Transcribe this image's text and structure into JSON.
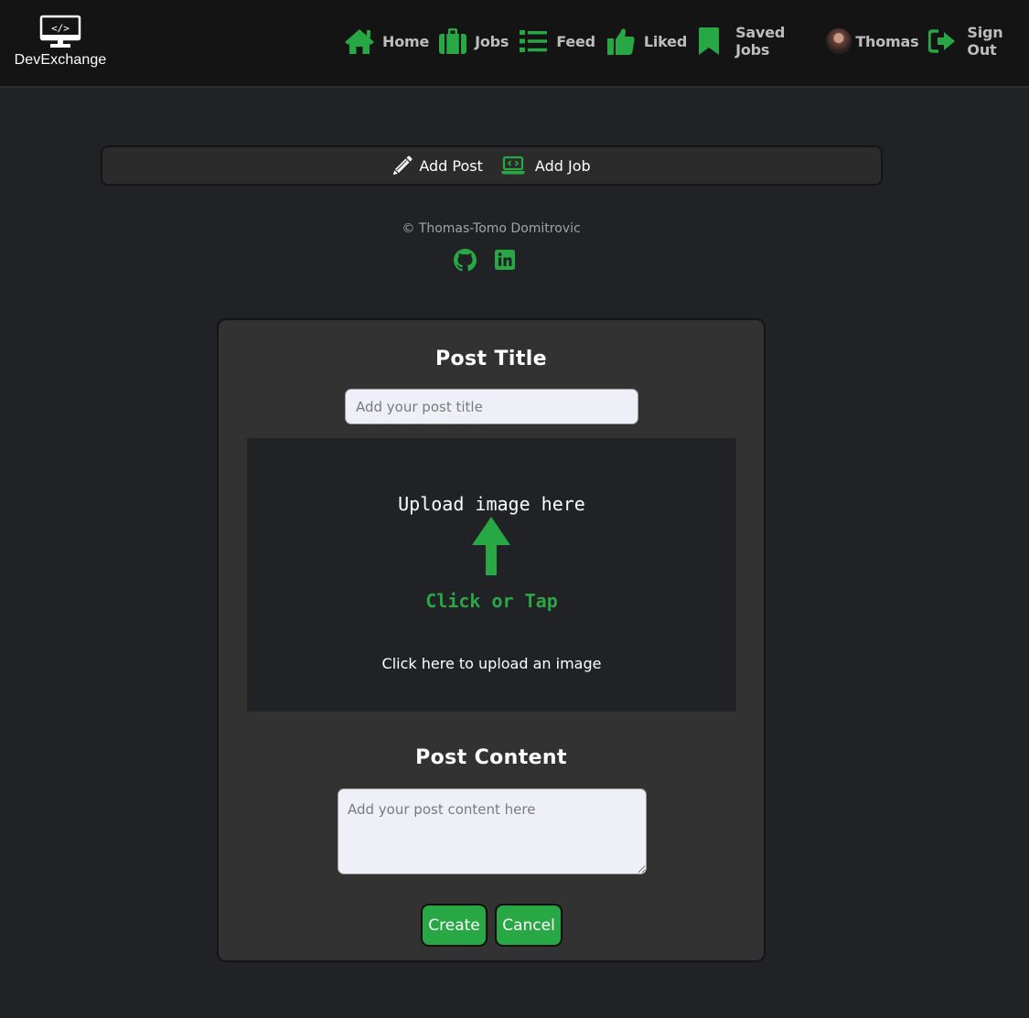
{
  "brand": {
    "name": "DevExchange",
    "icon": "monitor-code-icon"
  },
  "nav": {
    "items": [
      {
        "label": "Home",
        "icon": "home-icon"
      },
      {
        "label": "Jobs",
        "icon": "briefcase-icon"
      },
      {
        "label": "Feed",
        "icon": "list-icon"
      },
      {
        "label": "Liked",
        "icon": "thumbs-up-icon"
      },
      {
        "label": "Saved Jobs",
        "icon": "bookmark-icon"
      },
      {
        "label": "Thomas",
        "icon": "avatar"
      },
      {
        "label": "Sign Out",
        "icon": "sign-out-icon"
      }
    ]
  },
  "actions": {
    "add_post": "Add Post",
    "add_job": "Add Job"
  },
  "footer": {
    "copyright": "© Thomas-Tomo Domitrovic",
    "links": [
      "github-icon",
      "linkedin-icon"
    ]
  },
  "form": {
    "title_heading": "Post Title",
    "title_placeholder": "Add your post title",
    "upload_heading": "Upload image here",
    "upload_action": "Click or Tap",
    "upload_hint": "Click here to upload an image",
    "content_heading": "Post Content",
    "content_placeholder": "Add your post content here",
    "create_label": "Create",
    "cancel_label": "Cancel"
  },
  "colors": {
    "accent": "#28a745",
    "navbar_bg": "#141414",
    "page_bg": "#212226",
    "card_bg": "#323232",
    "input_bg": "#eff0f7"
  }
}
